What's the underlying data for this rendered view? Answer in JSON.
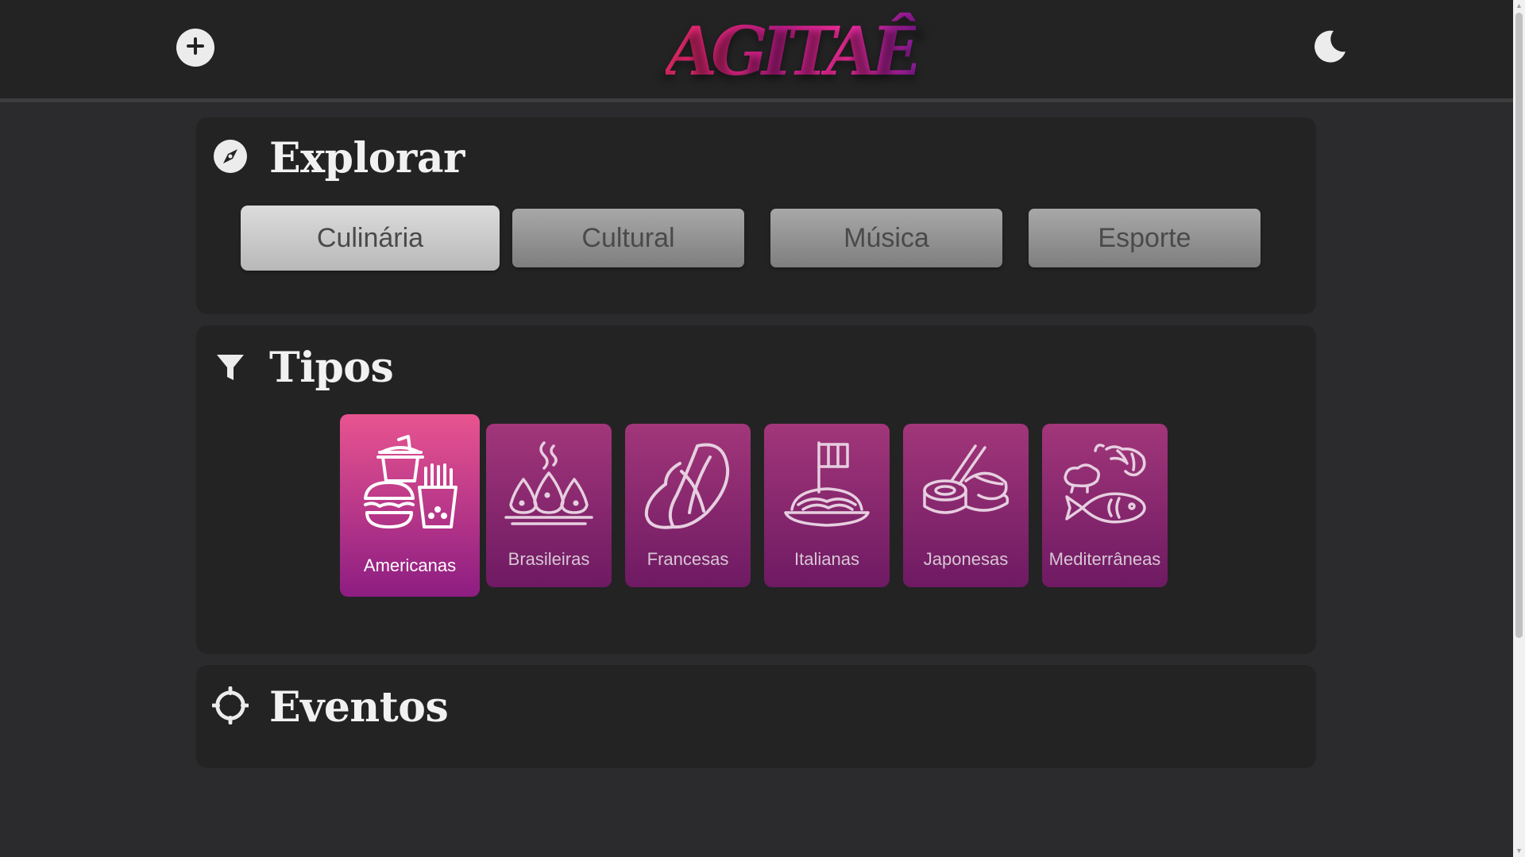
{
  "header": {
    "logo_text": "AGITAÊ",
    "add_icon": "plus-circle-icon",
    "theme_icon": "moon-icon"
  },
  "explorar": {
    "title": "Explorar",
    "icon": "compass-icon",
    "categories": [
      {
        "label": "Culinária",
        "active": true
      },
      {
        "label": "Cultural",
        "active": false
      },
      {
        "label": "Música",
        "active": false
      },
      {
        "label": "Esporte",
        "active": false
      }
    ]
  },
  "tipos": {
    "title": "Tipos",
    "icon": "filter-icon",
    "items": [
      {
        "label": "Americanas",
        "icon": "burger-fries-soda-icon",
        "active": true
      },
      {
        "label": "Brasileiras",
        "icon": "coxinha-plate-icon",
        "active": false
      },
      {
        "label": "Francesas",
        "icon": "croissant-icon",
        "active": false
      },
      {
        "label": "Italianas",
        "icon": "pasta-flag-icon",
        "active": false
      },
      {
        "label": "Japonesas",
        "icon": "sushi-chopsticks-icon",
        "active": false
      },
      {
        "label": "Mediterrâneas",
        "icon": "seafood-icon",
        "active": false
      }
    ]
  },
  "eventos": {
    "title": "Eventos",
    "icon": "crosshair-icon"
  },
  "colors": {
    "background": "#2b2b2d",
    "card": "#232323",
    "accent_pink": "#e85490",
    "accent_purple": "#8d1d82"
  }
}
